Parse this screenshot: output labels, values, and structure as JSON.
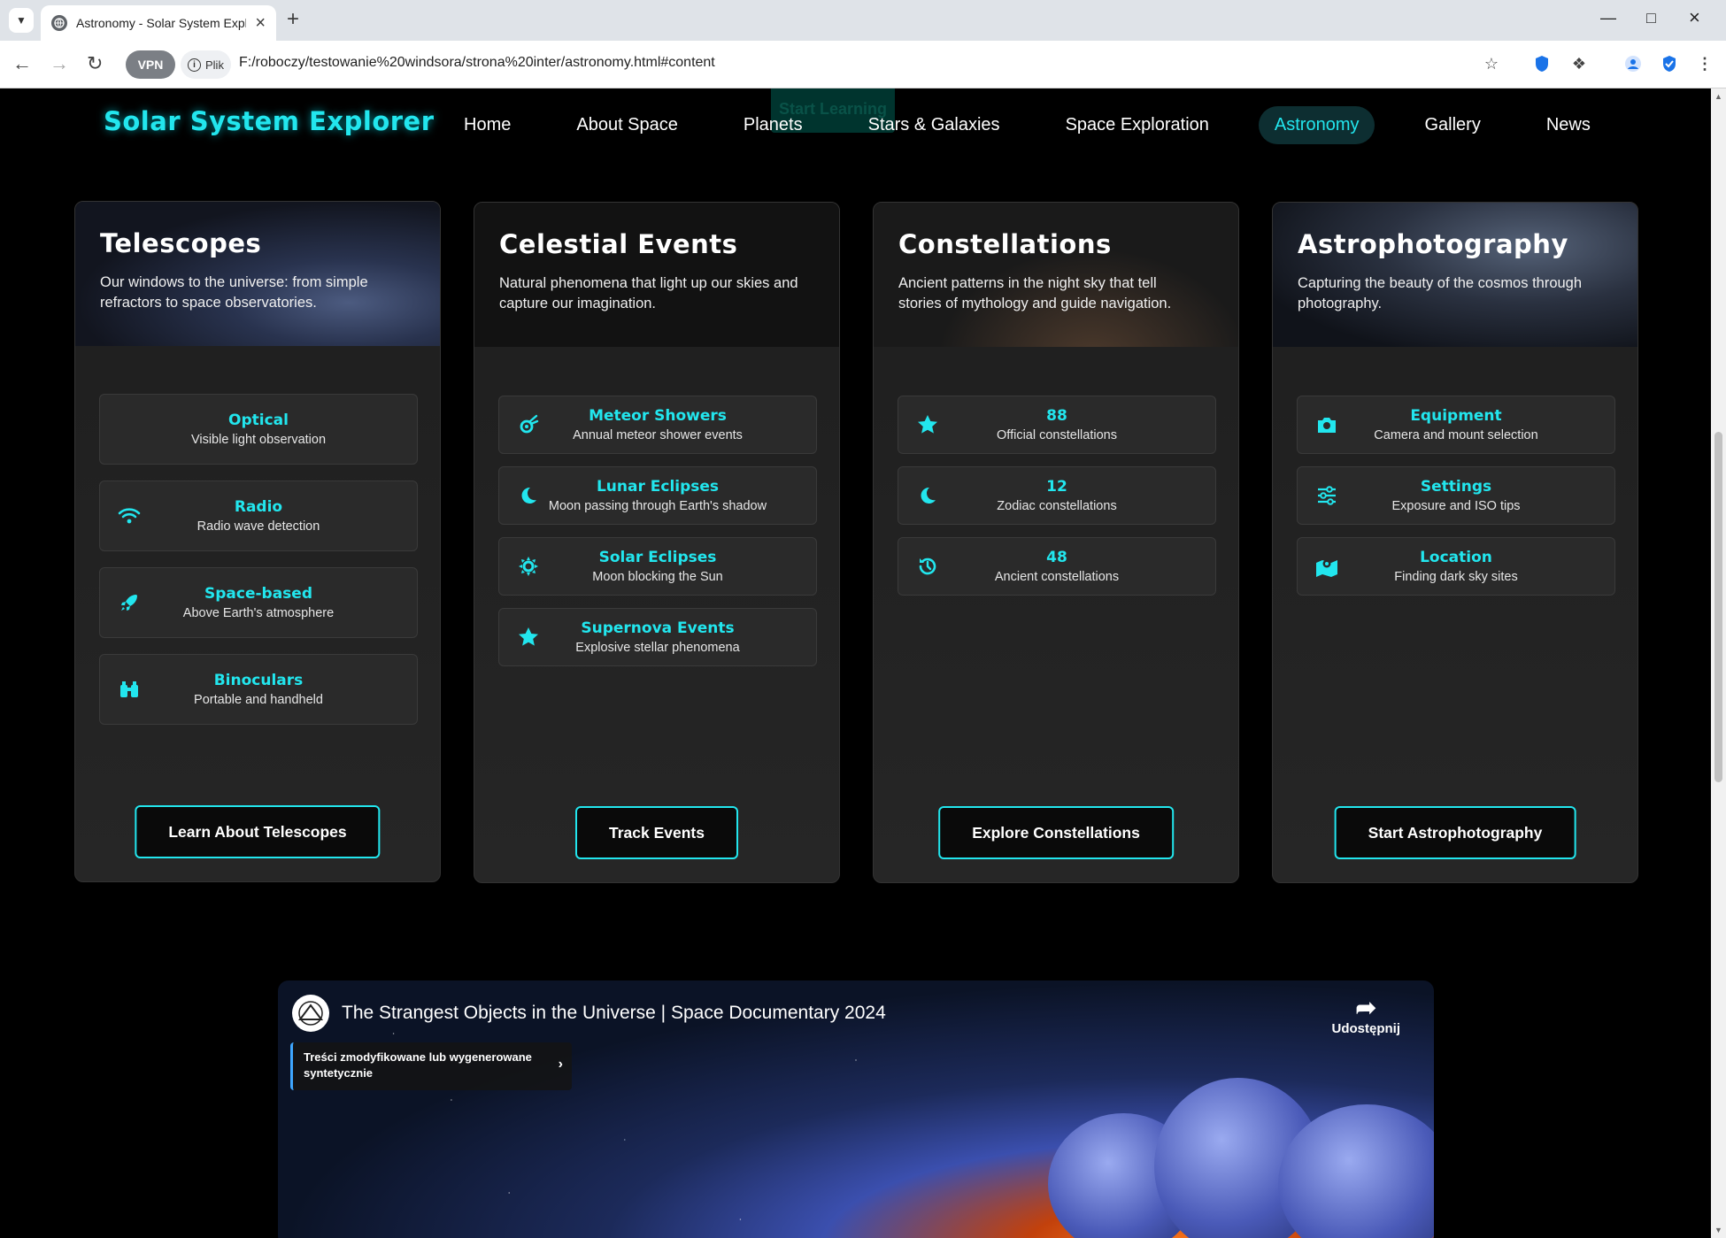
{
  "browser": {
    "tab_title": "Astronomy - Solar System Explorer",
    "url": "F:/roboczy/testowanie%20windsora/strona%20inter/astronomy.html#content",
    "vpn_label": "VPN",
    "file_label": "Plik"
  },
  "header": {
    "ghost_button": "Start Learning",
    "brand": "Solar System Explorer",
    "nav": [
      {
        "label": "Home",
        "active": false
      },
      {
        "label": "About Space",
        "active": false
      },
      {
        "label": "Planets",
        "active": false
      },
      {
        "label": "Stars & Galaxies",
        "active": false
      },
      {
        "label": "Space Exploration",
        "active": false
      },
      {
        "label": "Astronomy",
        "active": true
      },
      {
        "label": "Gallery",
        "active": false
      },
      {
        "label": "News",
        "active": false
      }
    ]
  },
  "cards": [
    {
      "title": "Telescopes",
      "desc": "Our windows to the universe: from simple refractors to space observatories.",
      "items": [
        {
          "title": "Optical",
          "sub": "Visible light observation",
          "icon": "eye-icon"
        },
        {
          "title": "Radio",
          "sub": "Radio wave detection",
          "icon": "wifi-icon"
        },
        {
          "title": "Space-based",
          "sub": "Above Earth's atmosphere",
          "icon": "rocket-icon"
        },
        {
          "title": "Binoculars",
          "sub": "Portable and handheld",
          "icon": "binoculars-icon"
        }
      ],
      "button": "Learn About Telescopes"
    },
    {
      "title": "Celestial Events",
      "desc": "Natural phenomena that light up our skies and capture our imagination.",
      "items": [
        {
          "title": "Meteor Showers",
          "sub": "Annual meteor shower events",
          "icon": "meteor-icon"
        },
        {
          "title": "Lunar Eclipses",
          "sub": "Moon passing through Earth's shadow",
          "icon": "moon-icon"
        },
        {
          "title": "Solar Eclipses",
          "sub": "Moon blocking the Sun",
          "icon": "sun-icon"
        },
        {
          "title": "Supernova Events",
          "sub": "Explosive stellar phenomena",
          "icon": "star-icon"
        }
      ],
      "button": "Track Events"
    },
    {
      "title": "Constellations",
      "desc": "Ancient patterns in the night sky that tell stories of mythology and guide navigation.",
      "items": [
        {
          "title": "88",
          "sub": "Official constellations",
          "icon": "star-icon"
        },
        {
          "title": "12",
          "sub": "Zodiac constellations",
          "icon": "moon-icon"
        },
        {
          "title": "48",
          "sub": "Ancient constellations",
          "icon": "history-icon"
        }
      ],
      "button": "Explore Constellations"
    },
    {
      "title": "Astrophotography",
      "desc": "Capturing the beauty of the cosmos through photography.",
      "items": [
        {
          "title": "Equipment",
          "sub": "Camera and mount selection",
          "icon": "camera-icon"
        },
        {
          "title": "Settings",
          "sub": "Exposure and ISO tips",
          "icon": "sliders-icon"
        },
        {
          "title": "Location",
          "sub": "Finding dark sky sites",
          "icon": "map-pin-icon"
        }
      ],
      "button": "Start Astrophotography"
    }
  ],
  "video": {
    "title": "The Strangest Objects in the Universe | Space Documentary 2024",
    "share_label": "Udostępnij",
    "badge": "Treści zmodyfikowane lub wygenerowane syntetycznie"
  },
  "colors": {
    "accent": "#22e6ee",
    "card_bg": "#222222",
    "page_bg": "#000000"
  }
}
